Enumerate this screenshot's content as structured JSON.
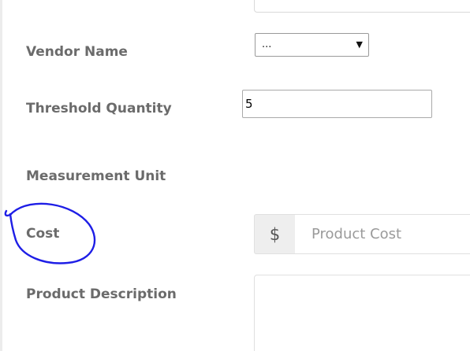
{
  "form": {
    "vendor_name": {
      "label": "Vendor Name",
      "selected": "..."
    },
    "threshold_quantity": {
      "label": "Threshold Quantity",
      "value": "5"
    },
    "measurement_unit": {
      "label": "Measurement Unit"
    },
    "cost": {
      "label": "Cost",
      "currency_symbol": "$",
      "placeholder": "Product Cost"
    },
    "product_description": {
      "label": "Product Description"
    }
  },
  "annotation": {
    "color": "#1e1ee6",
    "shape": "freehand-circle",
    "target": "cost-label"
  }
}
